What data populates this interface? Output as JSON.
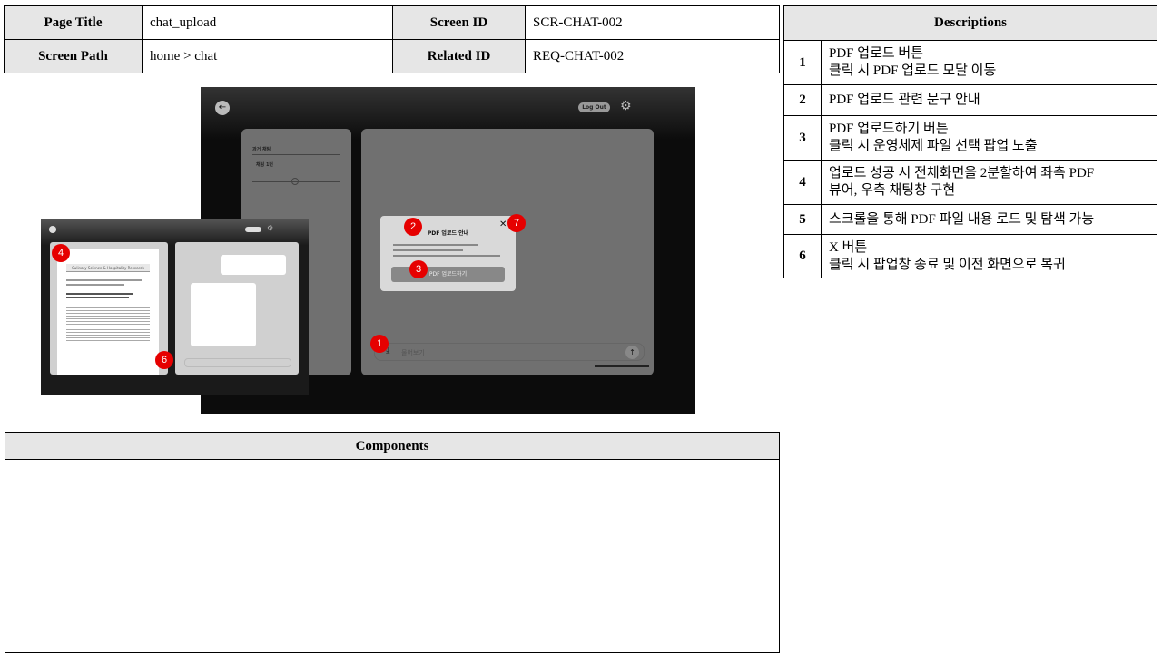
{
  "meta": {
    "page_title_label": "Page Title",
    "page_title": "chat_upload",
    "screen_id_label": "Screen ID",
    "screen_id": "SCR-CHAT-002",
    "screen_path_label": "Screen Path",
    "screen_path": "home > chat",
    "related_id_label": "Related ID",
    "related_id": "REQ-CHAT-002"
  },
  "descriptions": {
    "title": "Descriptions",
    "rows": [
      {
        "n": "1",
        "l1": "PDF 업로드 버튼",
        "l2": "클릭 시 PDF 업로드 모달 이동"
      },
      {
        "n": "2",
        "l1": "PDF 업로드 관련 문구 안내",
        "l2": ""
      },
      {
        "n": "3",
        "l1": "PDF 업로드하기 버튼",
        "l2": "클릭 시 운영체제 파일 선택 팝업 노출"
      },
      {
        "n": "4",
        "l1": "업로드 성공 시 전체화면을 2분할하여 좌측 PDF",
        "l2": "뷰어, 우측 채팅창 구현"
      },
      {
        "n": "5",
        "l1": "스크롤을 통해 PDF 파일 내용 로드 및 탐색 가능",
        "l2": ""
      },
      {
        "n": "6",
        "l1": "X 버튼",
        "l2": "클릭 시 팝업창 종료 및 이전 화면으로 복귀"
      }
    ]
  },
  "components": {
    "title": "Components"
  },
  "mockup": {
    "logout": "Log Out",
    "history_title": "과거 채팅",
    "chat_item": "채팅 1번",
    "modal_title": "PDF 업로드 안내",
    "modal_button": "PDF 업로드하기",
    "input_placeholder": "물어보기",
    "pdf_journal": "Culinary Science & Hospitality Research",
    "badges": {
      "b1": "1",
      "b2": "2",
      "b3": "3",
      "b4": "4",
      "b6": "6",
      "b7": "7"
    },
    "colors": {
      "badge": "#e60000",
      "panel": "#707070",
      "background": "#0c0c0c"
    }
  }
}
